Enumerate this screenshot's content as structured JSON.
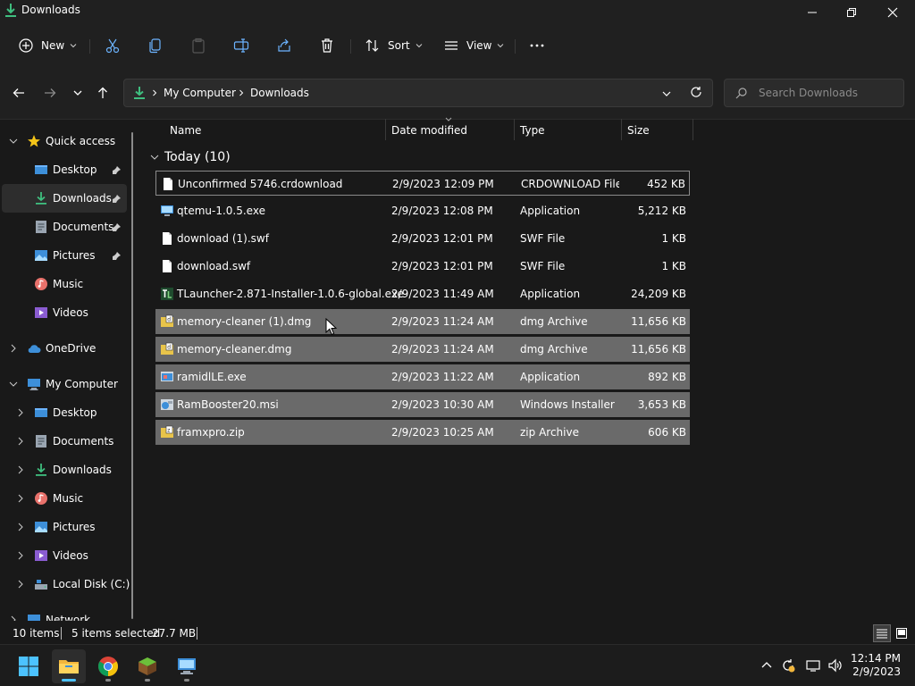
{
  "window": {
    "title": "Downloads"
  },
  "toolbar": {
    "new_label": "New",
    "sort_label": "Sort",
    "view_label": "View"
  },
  "address": {
    "crumbs": [
      "My Computer",
      "Downloads"
    ]
  },
  "search": {
    "placeholder": "Search Downloads"
  },
  "sidebar": {
    "items": [
      {
        "label": "Quick access"
      },
      {
        "label": "Desktop"
      },
      {
        "label": "Downloads"
      },
      {
        "label": "Documents"
      },
      {
        "label": "Pictures"
      },
      {
        "label": "Music"
      },
      {
        "label": "Videos"
      },
      {
        "label": "OneDrive"
      },
      {
        "label": "My Computer"
      },
      {
        "label": "Desktop"
      },
      {
        "label": "Documents"
      },
      {
        "label": "Downloads"
      },
      {
        "label": "Music"
      },
      {
        "label": "Pictures"
      },
      {
        "label": "Videos"
      },
      {
        "label": "Local Disk (C:)"
      },
      {
        "label": "Network"
      }
    ]
  },
  "columns": {
    "name": "Name",
    "date": "Date modified",
    "type": "Type",
    "size": "Size"
  },
  "group": {
    "label": "Today (10)"
  },
  "files": [
    {
      "name": "Unconfirmed 5746.crdownload",
      "date": "2/9/2023 12:09 PM",
      "type": "CRDOWNLOAD File",
      "size": "452 KB"
    },
    {
      "name": "qtemu-1.0.5.exe",
      "date": "2/9/2023 12:08 PM",
      "type": "Application",
      "size": "5,212 KB"
    },
    {
      "name": "download (1).swf",
      "date": "2/9/2023 12:01 PM",
      "type": "SWF File",
      "size": "1 KB"
    },
    {
      "name": "download.swf",
      "date": "2/9/2023 12:01 PM",
      "type": "SWF File",
      "size": "1 KB"
    },
    {
      "name": "TLauncher-2.871-Installer-1.0.6-global.exe",
      "date": "2/9/2023 11:49 AM",
      "type": "Application",
      "size": "24,209 KB"
    },
    {
      "name": "memory-cleaner (1).dmg",
      "date": "2/9/2023 11:24 AM",
      "type": "dmg Archive",
      "size": "11,656 KB"
    },
    {
      "name": "memory-cleaner.dmg",
      "date": "2/9/2023 11:24 AM",
      "type": "dmg Archive",
      "size": "11,656 KB"
    },
    {
      "name": "ramidlLE.exe",
      "date": "2/9/2023 11:22 AM",
      "type": "Application",
      "size": "892 KB"
    },
    {
      "name": "RamBooster20.msi",
      "date": "2/9/2023 10:30 AM",
      "type": "Windows Installer ...",
      "size": "3,653 KB"
    },
    {
      "name": "framxpro.zip",
      "date": "2/9/2023 10:25 AM",
      "type": "zip Archive",
      "size": "606 KB"
    }
  ],
  "status": {
    "count": "10 items",
    "selected": "5 items selected",
    "size": "27.7 MB"
  },
  "clock": {
    "time": "12:14 PM",
    "date": "2/9/2023"
  },
  "colors": {
    "accent": "#4cc2ff",
    "selection": "#6a6a6a",
    "background": "#191919"
  }
}
